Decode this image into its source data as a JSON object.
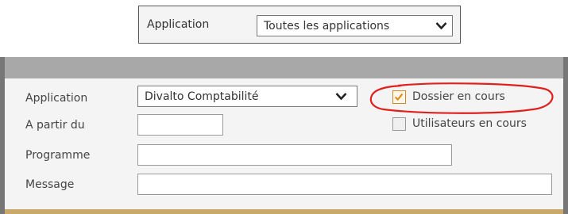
{
  "top_filter": {
    "label": "Application",
    "selected": "Toutes les applications",
    "chevron_icon": "chevron-down-icon"
  },
  "form": {
    "application": {
      "label": "Application",
      "selected": "Divalto Comptabilité"
    },
    "a_partir_du": {
      "label": "A partir du",
      "value": ""
    },
    "programme": {
      "label": "Programme",
      "value": ""
    },
    "message": {
      "label": "Message",
      "value": ""
    },
    "dossier_en_cours": {
      "label": "Dossier en cours",
      "checked": true
    },
    "utilisateurs_en_cours": {
      "label": "Utilisateurs en cours",
      "checked": false
    }
  },
  "colors": {
    "checkmark": "#e08a1e",
    "highlight_circle": "#e0201c",
    "header_bar": "#a8a8a8",
    "panel_background": "#f4f4f4"
  }
}
